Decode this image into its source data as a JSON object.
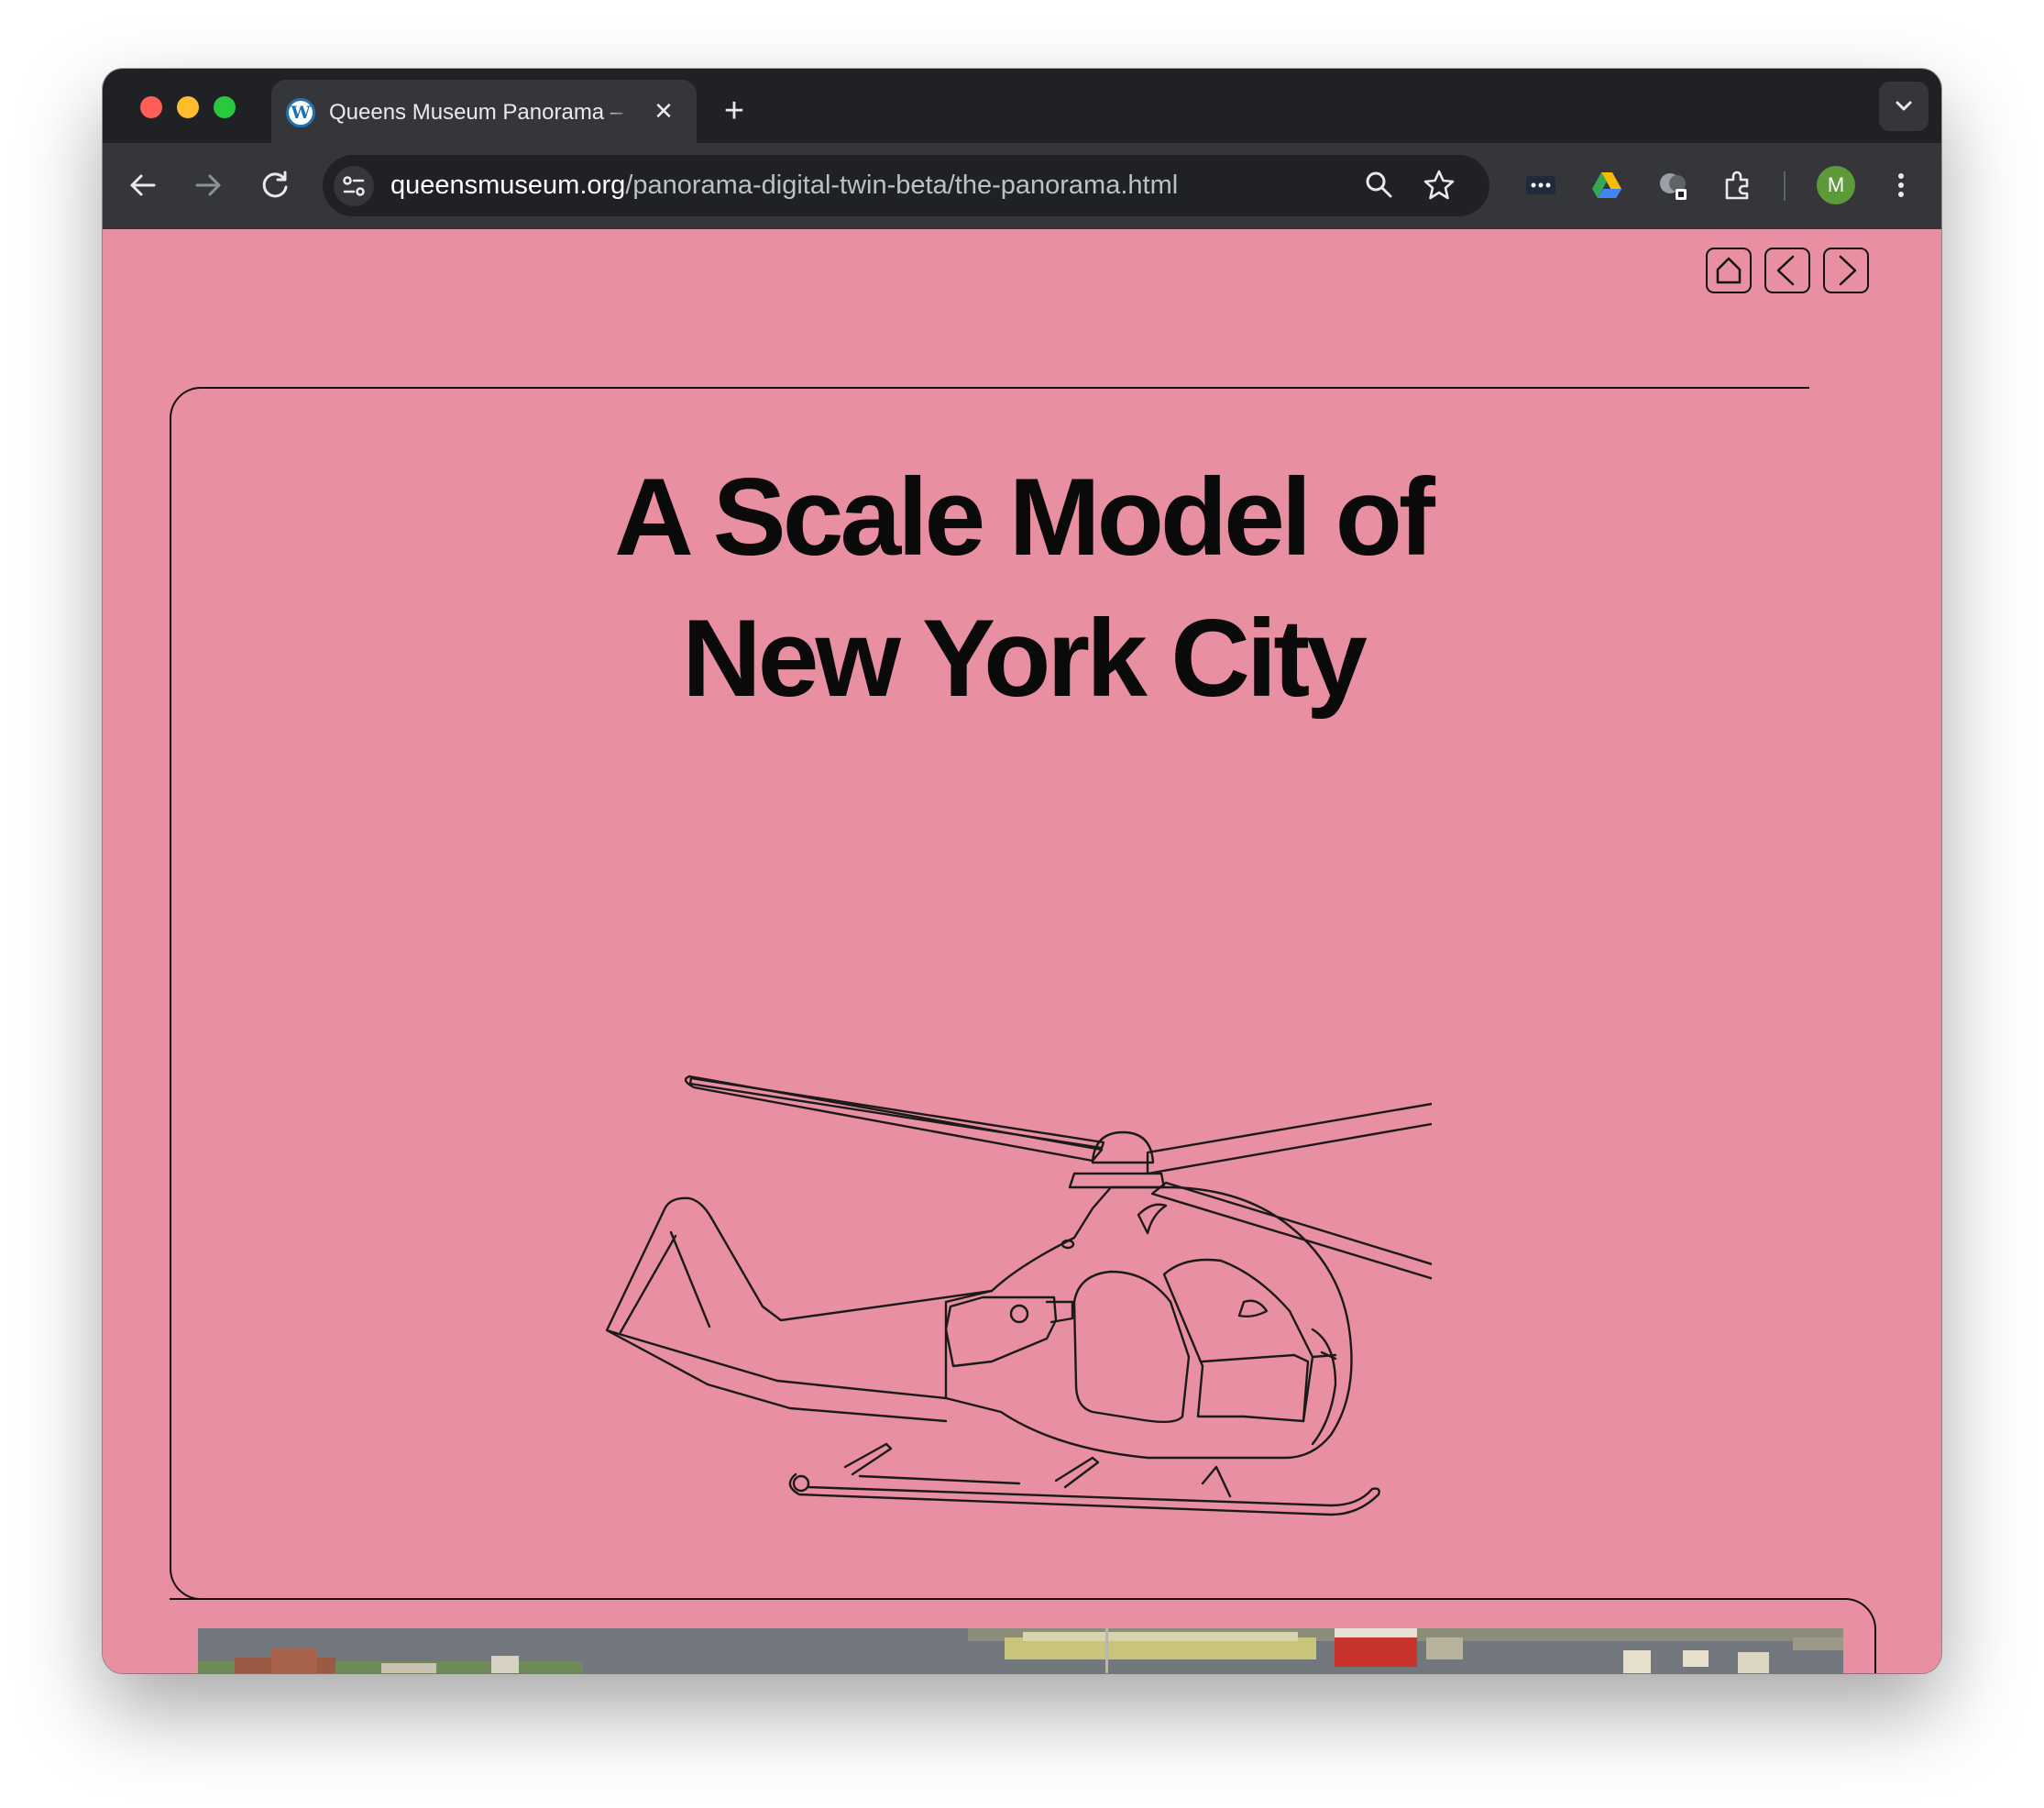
{
  "browser": {
    "tab": {
      "title": "Queens Museum Panorama – ",
      "favicon": "wordpress-icon",
      "close_glyph": "✕"
    },
    "new_tab_glyph": "+",
    "url": {
      "host": "queensmuseum.org",
      "path": "/panorama-digital-twin-beta/the-panorama.html"
    },
    "profile_initial": "M",
    "extensions": [
      "more-dots-extension-icon",
      "google-drive-icon",
      "grayscale-extension-icon",
      "puzzle-extensions-icon"
    ],
    "colors": {
      "frame": "#202124",
      "toolbar": "#35363a",
      "avatar": "#5c9a3a"
    }
  },
  "page": {
    "background": "#e98fa2",
    "nav": [
      "home-icon",
      "previous-icon",
      "next-icon"
    ],
    "headline": {
      "line1": "A Scale Model of",
      "line2": "New York City"
    },
    "illustration": "helicopter-line-drawing",
    "photo": "panorama-model-photo"
  }
}
